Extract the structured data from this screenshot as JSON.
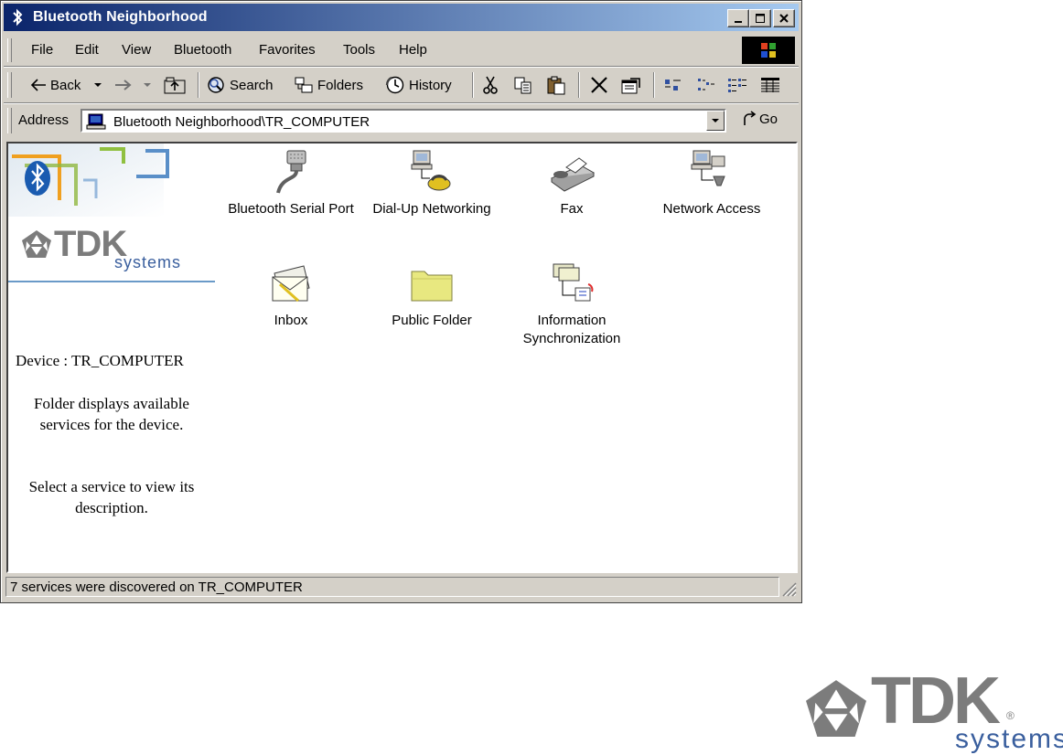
{
  "window": {
    "title": "Bluetooth Neighborhood",
    "controls": [
      "minimize",
      "maximize",
      "close"
    ]
  },
  "menu": {
    "items": [
      "File",
      "Edit",
      "View",
      "Bluetooth",
      "Favorites",
      "Tools",
      "Help"
    ]
  },
  "toolbar": {
    "back_label": "Back",
    "search_label": "Search",
    "folders_label": "Folders",
    "history_label": "History"
  },
  "address": {
    "label": "Address",
    "value": "Bluetooth Neighborhood\\TR_COMPUTER",
    "go_label": "Go"
  },
  "left_panel": {
    "logo_text": "TDK",
    "logo_sub": "systems",
    "device_line": "Device : TR_COMPUTER",
    "description_1": "Folder displays available services for the device.",
    "description_2": "Select a service to view its description."
  },
  "services": [
    {
      "label": "Bluetooth Serial Port",
      "icon": "serial-port-icon"
    },
    {
      "label": "Dial-Up Networking",
      "icon": "dial-up-icon"
    },
    {
      "label": "Fax",
      "icon": "fax-icon"
    },
    {
      "label": "Network Access",
      "icon": "network-access-icon"
    },
    {
      "label": "Inbox",
      "icon": "inbox-icon"
    },
    {
      "label": "Public Folder",
      "icon": "folder-icon"
    },
    {
      "label": "Information Synchronization",
      "icon": "sync-icon"
    }
  ],
  "status": {
    "text": "7 services were discovered on TR_COMPUTER"
  },
  "footer_logo": {
    "text": "TDK",
    "sub": "systems"
  },
  "colors": {
    "title_gradient_start": "#0a246a",
    "title_gradient_end": "#a6caf0",
    "chrome": "#d4d0c8",
    "tdk_gray": "#7c7c7c",
    "tdk_blue": "#3a5f9e"
  }
}
